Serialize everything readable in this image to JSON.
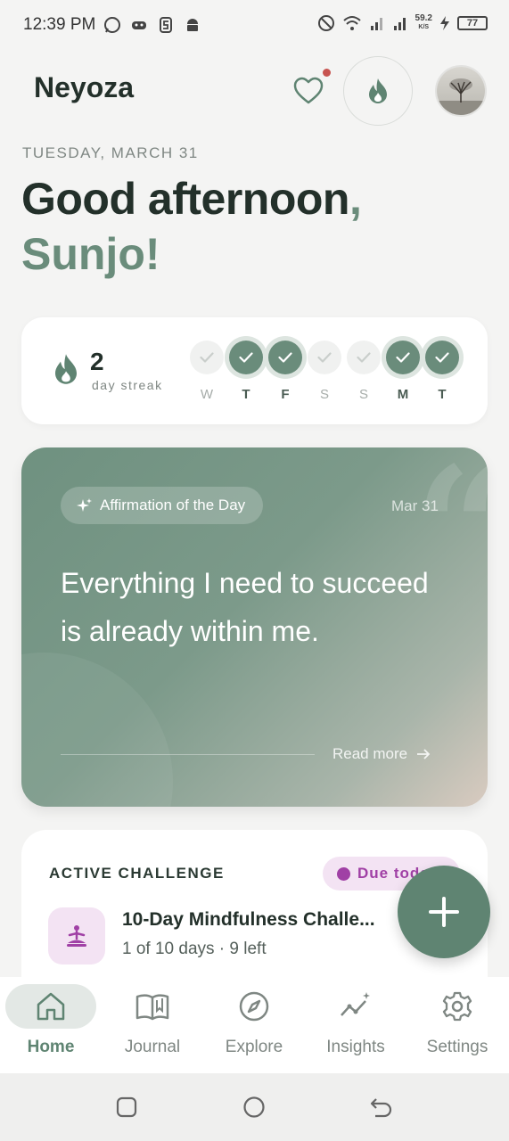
{
  "status": {
    "time": "12:39 PM",
    "speed_value": "59.2",
    "speed_unit": "K/S",
    "battery": "77"
  },
  "header": {
    "app_title": "Neyoza"
  },
  "greeting": {
    "date": "TUESDAY, MARCH 31",
    "line1": "Good afternoon",
    "comma": ",",
    "name": "Sunjo!"
  },
  "streak": {
    "count": "2",
    "label": "day streak",
    "days": [
      {
        "letter": "W",
        "done": false
      },
      {
        "letter": "T",
        "done": true
      },
      {
        "letter": "F",
        "done": true
      },
      {
        "letter": "S",
        "done": false
      },
      {
        "letter": "S",
        "done": false
      },
      {
        "letter": "M",
        "done": true
      },
      {
        "letter": "T",
        "done": true
      }
    ]
  },
  "affirmation": {
    "badge": "Affirmation of the Day",
    "date": "Mar 31",
    "text": "Everything I need to succeed is already within me.",
    "read_more": "Read more"
  },
  "challenge": {
    "section_title": "ACTIVE CHALLENGE",
    "badge": "Due today",
    "name": "10-Day Mindfulness Challe...",
    "progress": "1 of 10 days · 9 left"
  },
  "nav": {
    "items": [
      {
        "label": "Home",
        "icon": "home-icon"
      },
      {
        "label": "Journal",
        "icon": "book-icon"
      },
      {
        "label": "Explore",
        "icon": "compass-icon"
      },
      {
        "label": "Insights",
        "icon": "insights-icon"
      },
      {
        "label": "Settings",
        "icon": "gear-icon"
      }
    ]
  },
  "colors": {
    "accent": "#6a8c7b",
    "challenge": "#a040a5"
  }
}
